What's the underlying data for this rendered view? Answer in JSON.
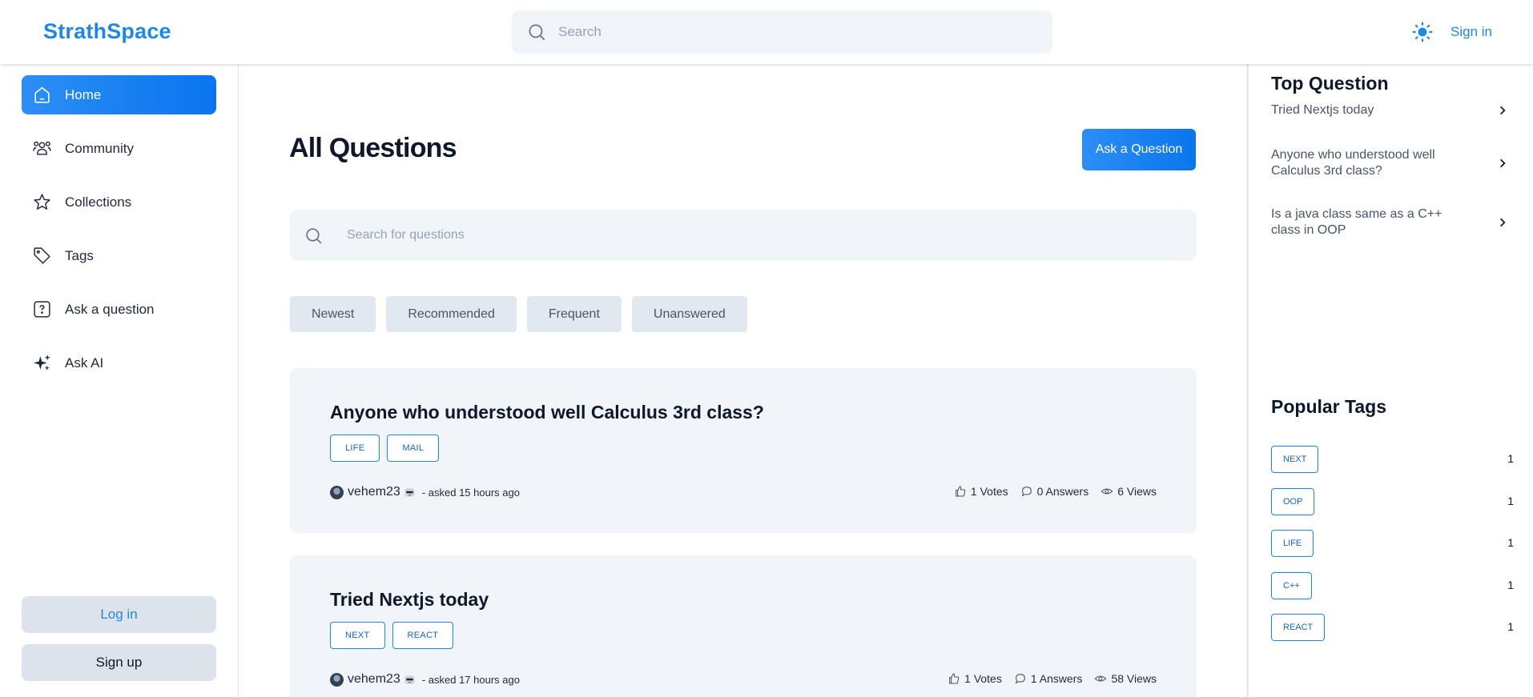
{
  "header": {
    "logo": "StrathSpace",
    "search_placeholder": "Search",
    "signin_label": "Sign in"
  },
  "sidebar": {
    "items": [
      {
        "label": "Home",
        "icon": "home-icon",
        "active": true
      },
      {
        "label": "Community",
        "icon": "community-icon"
      },
      {
        "label": "Collections",
        "icon": "star-icon"
      },
      {
        "label": "Tags",
        "icon": "tag-icon"
      },
      {
        "label": "Ask a question",
        "icon": "question-icon"
      },
      {
        "label": "Ask AI",
        "icon": "sparkles-icon"
      }
    ],
    "login_label": "Log in",
    "signup_label": "Sign up"
  },
  "main": {
    "title": "All Questions",
    "ask_button": "Ask a Question",
    "search_placeholder": "Search for questions",
    "filters": [
      "Newest",
      "Recommended",
      "Frequent",
      "Unanswered"
    ],
    "questions": [
      {
        "title": "Anyone who understood well Calculus 3rd class?",
        "tags": [
          "LIFE",
          "MAIL"
        ],
        "author": "vehem23",
        "asked": "- asked 15 hours ago",
        "votes": "1 Votes",
        "answers": "0 Answers",
        "views": "6 Views"
      },
      {
        "title": "Tried Nextjs today",
        "tags": [
          "NEXT",
          "REACT"
        ],
        "author": "vehem23",
        "asked": "- asked 17 hours ago",
        "votes": "1 Votes",
        "answers": "1 Answers",
        "views": "58 Views"
      }
    ]
  },
  "rightbar": {
    "top_title": "Top Question",
    "top_questions": [
      "Tried Nextjs today",
      "Anyone who understood well Calculus 3rd class?",
      "Is a java class same as a C++ class in OOP"
    ],
    "tags_title": "Popular Tags",
    "popular_tags": [
      {
        "name": "NEXT",
        "count": "1"
      },
      {
        "name": "OOP",
        "count": "1"
      },
      {
        "name": "LIFE",
        "count": "1"
      },
      {
        "name": "C++",
        "count": "1"
      },
      {
        "name": "REACT",
        "count": "1"
      }
    ]
  },
  "colors": {
    "primary": "#1e88e5",
    "card_bg": "#f1f5f9",
    "filter_bg": "#e2e8f0"
  }
}
